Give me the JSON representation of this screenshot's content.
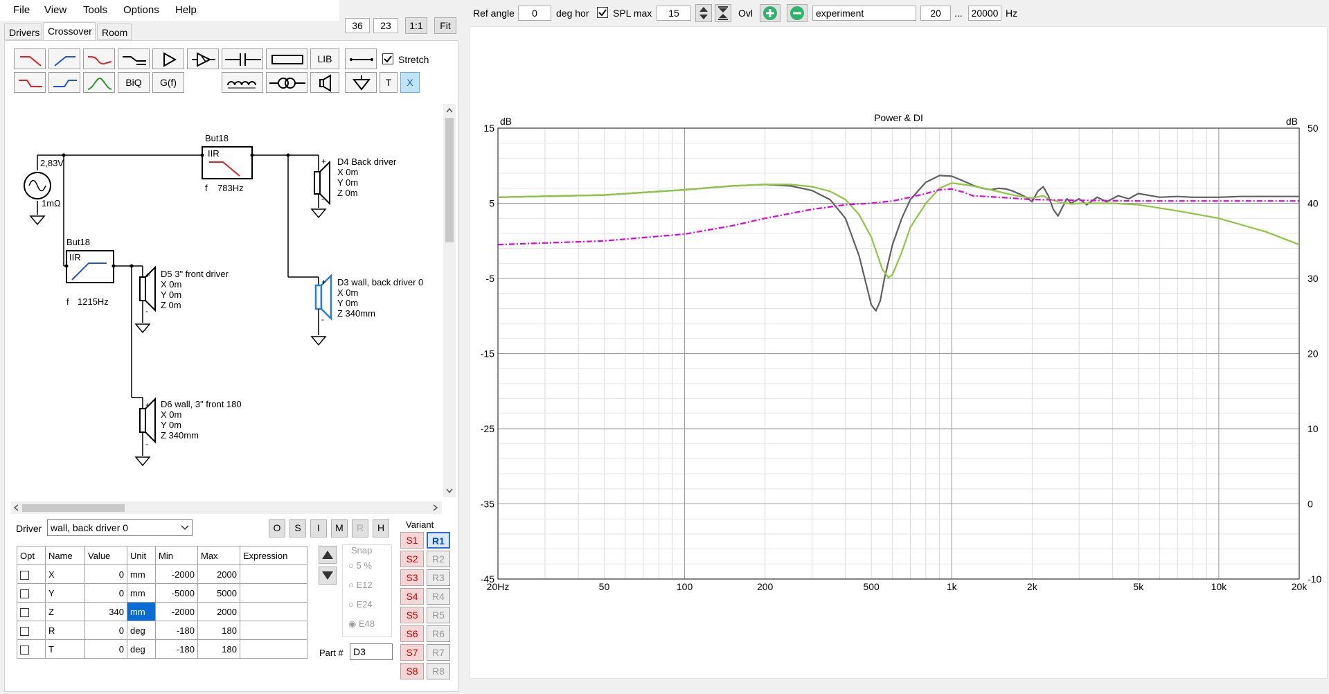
{
  "menu": {
    "file": "File",
    "view": "View",
    "tools": "Tools",
    "options": "Options",
    "help": "Help"
  },
  "topright": {
    "v1": "36",
    "v2": "23",
    "one_to_one": "1:1",
    "fit": "Fit"
  },
  "tabs": {
    "drivers": "Drivers",
    "crossover": "Crossover",
    "room": "Room"
  },
  "toolbar": {
    "lib": "LIB",
    "stretch": "Stretch",
    "biq": "BiQ",
    "gf": "G(f)",
    "t": "T",
    "x": "X"
  },
  "schematic": {
    "source_voltage": "2,83V",
    "source_r": "1mΩ",
    "but_top": "But18",
    "iir_top": "IIR",
    "f_top": "f",
    "freq_top": "783Hz",
    "but_left": "But18",
    "iir_left": "IIR",
    "f_left": "f",
    "freq_left": "1215Hz",
    "d4_name": "D4 Back driver",
    "d4_x": "X 0m",
    "d4_y": "Y 0m",
    "d4_z": "Z 0m",
    "d5_name": "D5 3\" front driver",
    "d5_x": "X 0m",
    "d5_y": "Y 0m",
    "d5_z": "Z 0m",
    "d3_name": "D3 wall, back driver 0",
    "d3_x": "X 0m",
    "d3_y": "Y 0m",
    "d3_z": "Z 340mm",
    "d6_name": "D6 wall, 3\" front 180",
    "d6_x": "X 0m",
    "d6_y": "Y 0m",
    "d6_z": "Z 340mm",
    "plus": "+",
    "minus": "-"
  },
  "driver_select": {
    "label": "Driver",
    "value": "wall, back driver 0"
  },
  "osim": [
    "O",
    "S",
    "I",
    "M",
    "R",
    "H"
  ],
  "param_table": {
    "headers": [
      "Opt",
      "Name",
      "Value",
      "Unit",
      "Min",
      "Max",
      "Expression"
    ],
    "rows": [
      {
        "name": "X",
        "value": "0",
        "unit": "mm",
        "min": "-2000",
        "max": "2000",
        "expr": ""
      },
      {
        "name": "Y",
        "value": "0",
        "unit": "mm",
        "min": "-5000",
        "max": "5000",
        "expr": ""
      },
      {
        "name": "Z",
        "value": "340",
        "unit": "mm",
        "min": "-2000",
        "max": "2000",
        "expr": ""
      },
      {
        "name": "R",
        "value": "0",
        "unit": "deg",
        "min": "-180",
        "max": "180",
        "expr": ""
      },
      {
        "name": "T",
        "value": "0",
        "unit": "deg",
        "min": "-180",
        "max": "180",
        "expr": ""
      }
    ]
  },
  "snap": {
    "title": "Snap",
    "o1": "5 %",
    "o2": "E12",
    "o3": "E24",
    "o4": "E48"
  },
  "part": {
    "label": "Part #",
    "value": "D3"
  },
  "variant": {
    "title": "Variant",
    "s": [
      "S1",
      "S2",
      "S3",
      "S4",
      "S5",
      "S6",
      "S7",
      "S8"
    ],
    "r": [
      "R1",
      "R2",
      "R3",
      "R4",
      "R5",
      "R6",
      "R7",
      "R8"
    ]
  },
  "top_toolbar": {
    "ref_angle_label": "Ref angle",
    "ref_angle_value": "0",
    "deg_hor": "deg hor",
    "spl_max_label": "SPL max",
    "spl_max_value": "15",
    "ovl": "Ovl",
    "name_value": "experiment",
    "fmin": "20",
    "dots": "...",
    "fmax": "20000",
    "hz": "Hz"
  },
  "colors": {
    "gray": "#606060",
    "green": "#8dc63f",
    "magenta": "#e000e0",
    "red": "#e02020",
    "blue": "#2050e0",
    "accent_green": "#2fb36b"
  },
  "chart_data": {
    "type": "line",
    "title": "Power & DI",
    "ylabel_left": "dB",
    "ylabel_right": "dB",
    "x_scale": "log",
    "xlim": [
      20,
      20000
    ],
    "ylim_left": [
      -45,
      15
    ],
    "ylim_right": [
      -10,
      50
    ],
    "x_ticks": [
      {
        "v": 20,
        "label": "20Hz"
      },
      {
        "v": 50,
        "label": "50"
      },
      {
        "v": 100,
        "label": "100"
      },
      {
        "v": 200,
        "label": "200"
      },
      {
        "v": 500,
        "label": "500"
      },
      {
        "v": 1000,
        "label": "1k"
      },
      {
        "v": 2000,
        "label": "2k"
      },
      {
        "v": 5000,
        "label": "5k"
      },
      {
        "v": 10000,
        "label": "10k"
      },
      {
        "v": 20000,
        "label": "20k"
      }
    ],
    "y_left_ticks": [
      "15",
      "5",
      "-5",
      "-15",
      "-25",
      "-35",
      "-45"
    ],
    "y_right_ticks": [
      "50",
      "40",
      "30",
      "20",
      "10",
      "0",
      "-10"
    ],
    "grid": true,
    "series": [
      {
        "color": "#606060",
        "style": "solid",
        "axis": "left",
        "x": [
          20,
          50,
          100,
          150,
          200,
          250,
          300,
          350,
          400,
          450,
          500,
          520,
          540,
          560,
          600,
          650,
          700,
          800,
          900,
          1000,
          1100,
          1200,
          1300,
          1400,
          1500,
          1600,
          1700,
          1800,
          1900,
          2000,
          2100,
          2200,
          2300,
          2400,
          2500,
          2600,
          2700,
          2800,
          3000,
          3200,
          3500,
          3800,
          4200,
          4600,
          5000,
          6000,
          7000,
          8000,
          10000,
          12000,
          15000,
          20000
        ],
        "y": [
          5.8,
          6.1,
          6.8,
          7.3,
          7.5,
          7.3,
          6.7,
          5.5,
          3.0,
          -2.0,
          -8.5,
          -9.3,
          -8.0,
          -5.0,
          -0.5,
          3.0,
          5.5,
          7.8,
          8.7,
          8.6,
          8.0,
          7.4,
          7.0,
          6.8,
          7.0,
          6.9,
          6.6,
          6.2,
          5.8,
          5.2,
          6.6,
          7.2,
          6.0,
          4.2,
          3.3,
          4.5,
          5.6,
          5.0,
          5.6,
          4.8,
          5.8,
          5.2,
          6.0,
          5.6,
          6.3,
          5.8,
          5.9,
          5.8,
          5.8,
          5.9,
          5.9,
          5.9
        ]
      },
      {
        "color": "#8dc63f",
        "style": "solid",
        "axis": "left",
        "x": [
          20,
          50,
          100,
          150,
          200,
          250,
          300,
          350,
          400,
          450,
          500,
          550,
          580,
          600,
          650,
          700,
          800,
          900,
          1000,
          1100,
          1200,
          1400,
          1600,
          1800,
          2000,
          2200,
          2300,
          2500,
          2800,
          3000,
          4000,
          5000,
          7000,
          10000,
          15000,
          20000
        ],
        "y": [
          5.8,
          6.1,
          6.8,
          7.3,
          7.5,
          7.5,
          7.2,
          6.6,
          5.5,
          3.5,
          0.5,
          -3.8,
          -4.9,
          -4.5,
          -1.5,
          1.8,
          5.0,
          7.0,
          7.7,
          7.5,
          7.3,
          6.8,
          6.3,
          5.9,
          5.7,
          6.0,
          5.6,
          5.2,
          4.9,
          5.0,
          5.0,
          4.8,
          4.0,
          3.0,
          1.2,
          -0.5
        ]
      },
      {
        "color": "#e000e0",
        "style": "dashdot",
        "axis": "left",
        "x": [
          20,
          50,
          100,
          150,
          200,
          300,
          400,
          500,
          600,
          700,
          800,
          900,
          1000,
          1100,
          1200,
          1500,
          2000,
          3000,
          5000,
          10000,
          20000
        ],
        "y": [
          -0.5,
          0.0,
          0.9,
          2.0,
          3.0,
          4.2,
          4.8,
          5.0,
          5.3,
          5.8,
          6.3,
          6.8,
          6.9,
          6.5,
          6.0,
          5.8,
          5.5,
          5.4,
          5.3,
          5.3,
          5.3
        ]
      }
    ]
  }
}
